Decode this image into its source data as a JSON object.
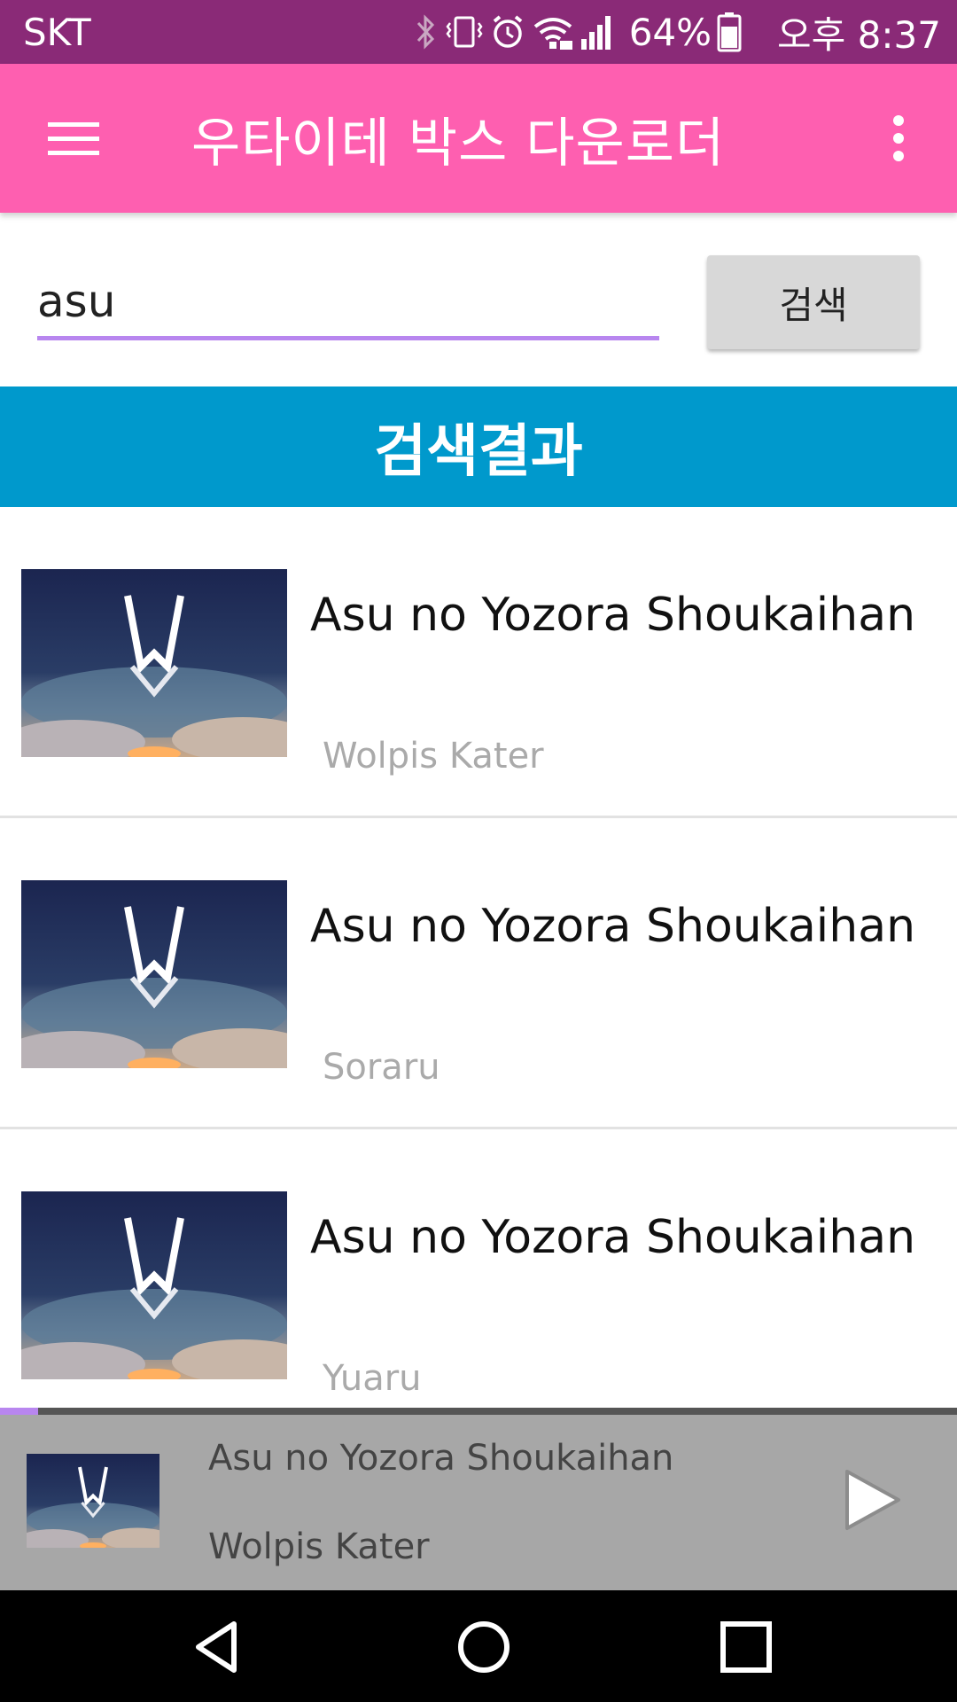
{
  "status_bar": {
    "carrier": "SKT",
    "battery_percent": "64%",
    "time": "오후 8:37",
    "icons": [
      "bluetooth-icon",
      "vibrate-icon",
      "alarm-icon",
      "wifi-icon",
      "cell-signal-icon",
      "battery-icon"
    ]
  },
  "app_bar": {
    "title": "우타이테 박스 다운로더",
    "menu_icon": "hamburger-menu-icon",
    "overflow_icon": "more-vert-icon",
    "color": "#fe5fb0"
  },
  "search": {
    "value": "asu",
    "button_label": "검색"
  },
  "results": {
    "header": "검색결과",
    "header_color": "#0099cc",
    "items": [
      {
        "title": "Asu no Yozora Shoukaihan",
        "artist": "Wolpis Kater"
      },
      {
        "title": "Asu no Yozora Shoukaihan",
        "artist": "Soraru"
      },
      {
        "title": "Asu no Yozora Shoukaihan",
        "artist": "Yuaru"
      }
    ]
  },
  "player": {
    "title": "Asu no Yozora Shoukaihan",
    "artist": "Wolpis Kater",
    "progress": 0.04,
    "play_icon": "play-icon"
  },
  "nav_bar": {
    "icons": [
      "back-icon",
      "home-icon",
      "recents-icon"
    ]
  }
}
